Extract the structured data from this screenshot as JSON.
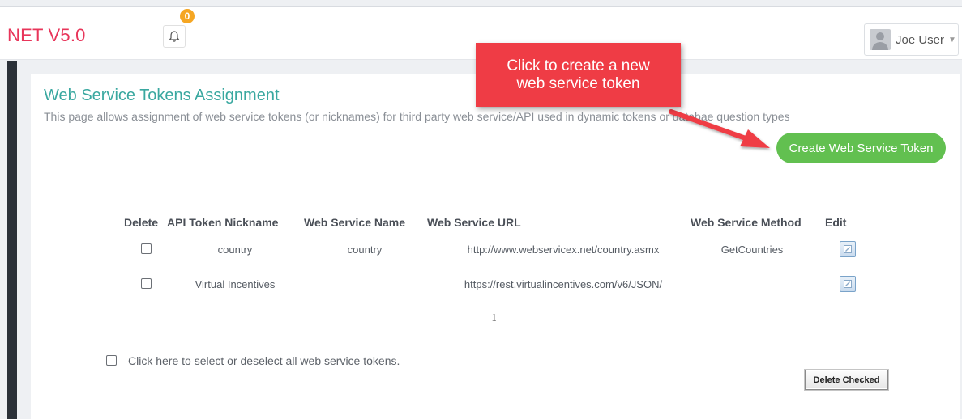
{
  "header": {
    "brand": "NET V5.0",
    "notification_count": "0",
    "user_name": "Joe User"
  },
  "page": {
    "title": "Web Service Tokens Assignment",
    "description": "This page allows assignment of web service tokens (or nicknames) for third party web service/API used in dynamic tokens or databae question types",
    "create_button": "Create Web Service Token"
  },
  "callout": {
    "line1": "Click to create a new",
    "line2": "web service token"
  },
  "table": {
    "headers": {
      "delete": "Delete",
      "nickname": "API Token Nickname",
      "service_name": "Web Service Name",
      "url": "Web Service URL",
      "method": "Web Service Method",
      "edit": "Edit"
    },
    "rows": [
      {
        "nickname": "country",
        "service_name": "country",
        "url": "http://www.webservicex.net/country.asmx",
        "method": "GetCountries"
      },
      {
        "nickname": "Virtual Incentives",
        "service_name": "",
        "url": "https://rest.virtualincentives.com/v6/JSON/",
        "method": ""
      }
    ],
    "pager": "1"
  },
  "footer": {
    "select_all_label": "Click here to select or deselect all web service tokens.",
    "delete_checked_button": "Delete Checked"
  },
  "colors": {
    "brand": "#e8355a",
    "title": "#3aa8a0",
    "create_button": "#62c050",
    "callout": "#ef3c45",
    "badge": "#f5a623"
  }
}
